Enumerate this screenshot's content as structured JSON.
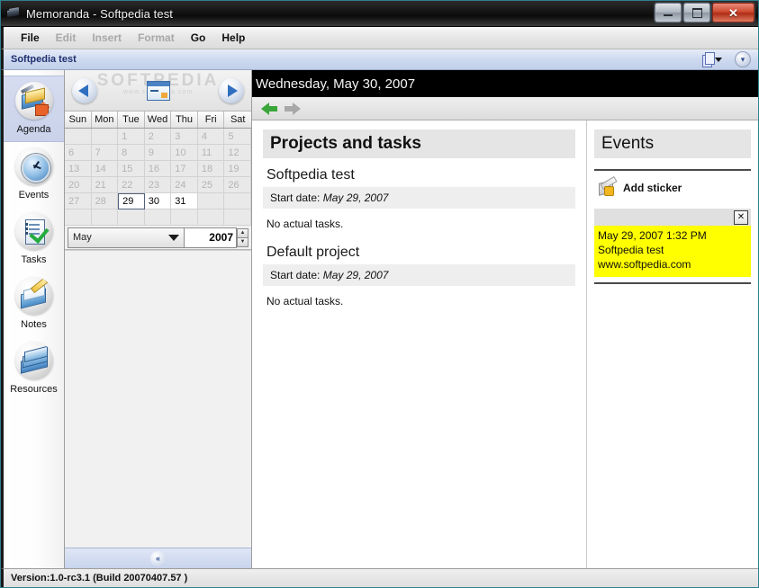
{
  "window": {
    "title": "Memoranda - Softpedia test",
    "app_icon": "notebook-icon",
    "buttons": {
      "minimize": "–",
      "maximize": "□",
      "close": "✕"
    }
  },
  "menubar": {
    "items": [
      {
        "label": "File",
        "enabled": true
      },
      {
        "label": "Edit",
        "enabled": false
      },
      {
        "label": "Insert",
        "enabled": false
      },
      {
        "label": "Format",
        "enabled": false
      },
      {
        "label": "Go",
        "enabled": true
      },
      {
        "label": "Help",
        "enabled": true
      }
    ]
  },
  "docbar": {
    "title": "Softpedia test",
    "new_doc_icon": "new-document-icon",
    "expand_icon": "chevron-double-down-icon"
  },
  "sidebar": {
    "items": [
      {
        "label": "Agenda",
        "icon": "agenda-icon",
        "selected": true
      },
      {
        "label": "Events",
        "icon": "clock-icon",
        "selected": false
      },
      {
        "label": "Tasks",
        "icon": "checklist-icon",
        "selected": false
      },
      {
        "label": "Notes",
        "icon": "notes-icon",
        "selected": false
      },
      {
        "label": "Resources",
        "icon": "folders-icon",
        "selected": false
      }
    ]
  },
  "calendar": {
    "watermark": "SOFTPEDIA",
    "watermark_sub": "www.softpedia.com",
    "prev_icon": "arrow-left-icon",
    "today_icon": "calendar-today-icon",
    "next_icon": "arrow-right-icon",
    "weekdays": [
      "Sun",
      "Mon",
      "Tue",
      "Wed",
      "Thu",
      "Fri",
      "Sat"
    ],
    "weeks": [
      [
        {
          "day": "",
          "state": "empty"
        },
        {
          "day": "",
          "state": "empty"
        },
        {
          "day": "1",
          "state": "past"
        },
        {
          "day": "2",
          "state": "past"
        },
        {
          "day": "3",
          "state": "past"
        },
        {
          "day": "4",
          "state": "past"
        },
        {
          "day": "5",
          "state": "past"
        }
      ],
      [
        {
          "day": "6",
          "state": "past"
        },
        {
          "day": "7",
          "state": "past"
        },
        {
          "day": "8",
          "state": "past"
        },
        {
          "day": "9",
          "state": "past"
        },
        {
          "day": "10",
          "state": "past"
        },
        {
          "day": "11",
          "state": "past"
        },
        {
          "day": "12",
          "state": "past"
        }
      ],
      [
        {
          "day": "13",
          "state": "past"
        },
        {
          "day": "14",
          "state": "past"
        },
        {
          "day": "15",
          "state": "past"
        },
        {
          "day": "16",
          "state": "past"
        },
        {
          "day": "17",
          "state": "past"
        },
        {
          "day": "18",
          "state": "past"
        },
        {
          "day": "19",
          "state": "past"
        }
      ],
      [
        {
          "day": "20",
          "state": "past"
        },
        {
          "day": "21",
          "state": "past"
        },
        {
          "day": "22",
          "state": "past"
        },
        {
          "day": "23",
          "state": "past"
        },
        {
          "day": "24",
          "state": "past"
        },
        {
          "day": "25",
          "state": "past"
        },
        {
          "day": "26",
          "state": "past"
        }
      ],
      [
        {
          "day": "27",
          "state": "past"
        },
        {
          "day": "28",
          "state": "past"
        },
        {
          "day": "29",
          "state": "selected"
        },
        {
          "day": "30",
          "state": "active"
        },
        {
          "day": "31",
          "state": "active"
        },
        {
          "day": "",
          "state": "empty"
        },
        {
          "day": "",
          "state": "empty"
        }
      ],
      [
        {
          "day": "",
          "state": "empty"
        },
        {
          "day": "",
          "state": "empty"
        },
        {
          "day": "",
          "state": "empty"
        },
        {
          "day": "",
          "state": "empty"
        },
        {
          "day": "",
          "state": "empty"
        },
        {
          "day": "",
          "state": "empty"
        },
        {
          "day": "",
          "state": "empty"
        }
      ]
    ],
    "month_selected": "May",
    "year_value": "2007",
    "collapse_label": "«"
  },
  "main": {
    "date_header": "Wednesday, May 30, 2007",
    "back_icon": "arrow-back-icon",
    "forward_icon": "arrow-forward-icon",
    "section_title": "Projects and tasks",
    "projects": [
      {
        "name": "Softpedia test",
        "start_label": "Start date:",
        "start_date": "May 29, 2007",
        "tasks_note": "No actual tasks."
      },
      {
        "name": "Default project",
        "start_label": "Start date:",
        "start_date": "May 29, 2007",
        "tasks_note": "No actual tasks."
      }
    ]
  },
  "events": {
    "title": "Events",
    "add_sticker_label": "Add sticker",
    "add_sticker_icon": "add-sticker-icon",
    "sticker": {
      "close_label": "✕",
      "timestamp": "May 29, 2007 1:32 PM",
      "line2": "Softpedia test",
      "line3": "www.softpedia.com",
      "color": "#ffff00"
    }
  },
  "statusbar": {
    "text": "Version:1.0-rc3.1 (Build 20070407.57 )"
  }
}
